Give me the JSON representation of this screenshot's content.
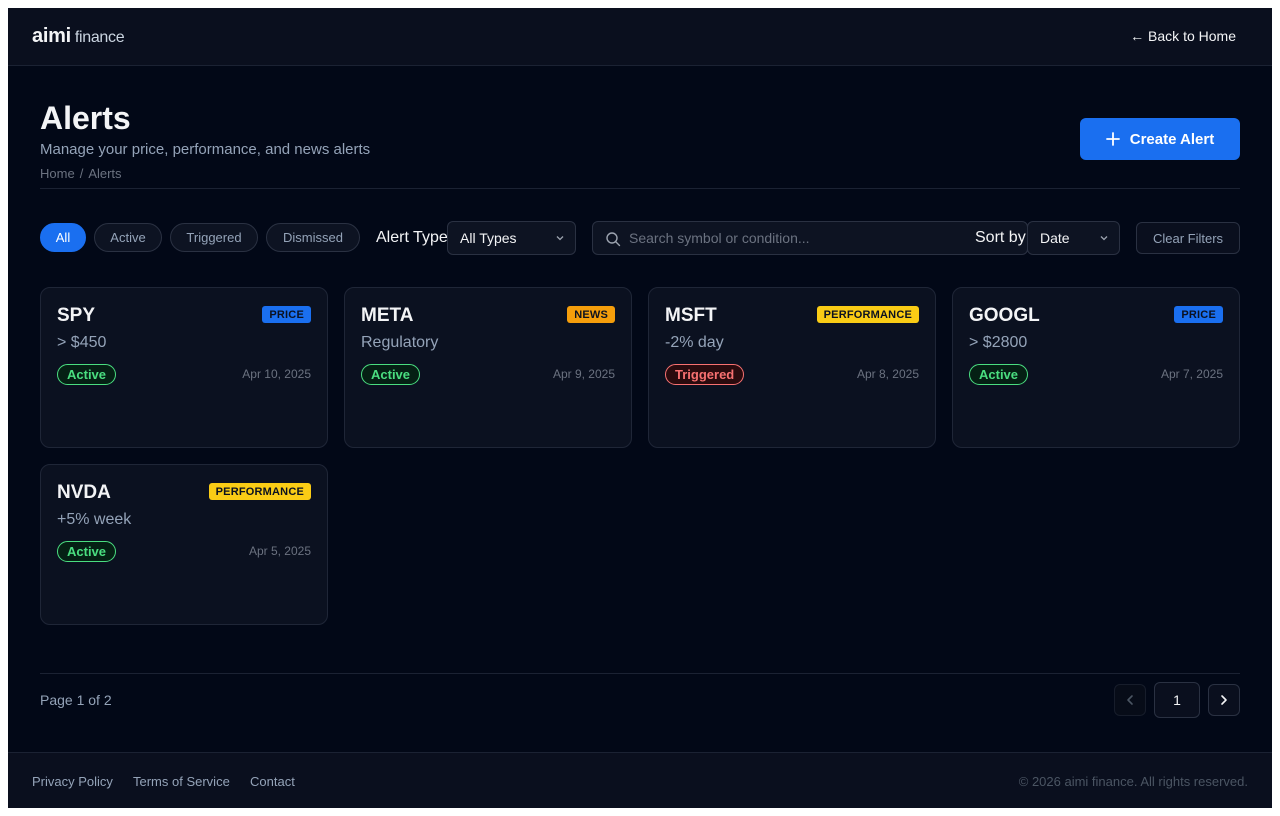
{
  "app": {
    "brand": "aimi",
    "brand_sub": "finance",
    "back_link": "← Back to Home"
  },
  "page": {
    "title": "Alerts",
    "subtitle": "Manage your price, performance, and news alerts",
    "breadcrumb": [
      "Home",
      "/",
      "Alerts"
    ],
    "create_label": "Create Alert"
  },
  "filters": {
    "status_pills": [
      {
        "label": "All",
        "selected": true
      },
      {
        "label": "Active",
        "selected": false
      },
      {
        "label": "Triggered",
        "selected": false
      },
      {
        "label": "Dismissed",
        "selected": false
      }
    ],
    "type_label": "Alert Type",
    "type_value": "All Types",
    "search_placeholder": "Search symbol or condition...",
    "sort_label": "Sort by",
    "sort_value": "Date",
    "clear_label": "Clear Filters"
  },
  "alerts": [
    {
      "symbol": "SPY",
      "type": "PRICE",
      "condition": "> $450",
      "status": "Active",
      "date": "Apr 10, 2025"
    },
    {
      "symbol": "META",
      "type": "NEWS",
      "condition": "Regulatory",
      "status": "Active",
      "date": "Apr 9, 2025"
    },
    {
      "symbol": "MSFT",
      "type": "PERFORMANCE",
      "condition": "-2% day",
      "status": "Triggered",
      "date": "Apr 8, 2025"
    },
    {
      "symbol": "GOOGL",
      "type": "PRICE",
      "condition": "> $2800",
      "status": "Active",
      "date": "Apr 7, 2025"
    },
    {
      "symbol": "NVDA",
      "type": "PERFORMANCE",
      "condition": "+5% week",
      "status": "Active",
      "date": "Apr 5, 2025"
    }
  ],
  "pagination": {
    "info": "Page 1 of 2",
    "current": "1"
  },
  "footer": {
    "links": [
      "Privacy Policy",
      "Terms of Service",
      "Contact"
    ],
    "copyright": "© 2026 aimi finance. All rights reserved."
  },
  "colors": {
    "accent": "#1a6ff0",
    "badge_price": "#1a6ff0",
    "badge_news": "#f59e0b",
    "badge_performance": "#facc15",
    "status_active": "#4ade80",
    "status_triggered": "#f87171"
  }
}
